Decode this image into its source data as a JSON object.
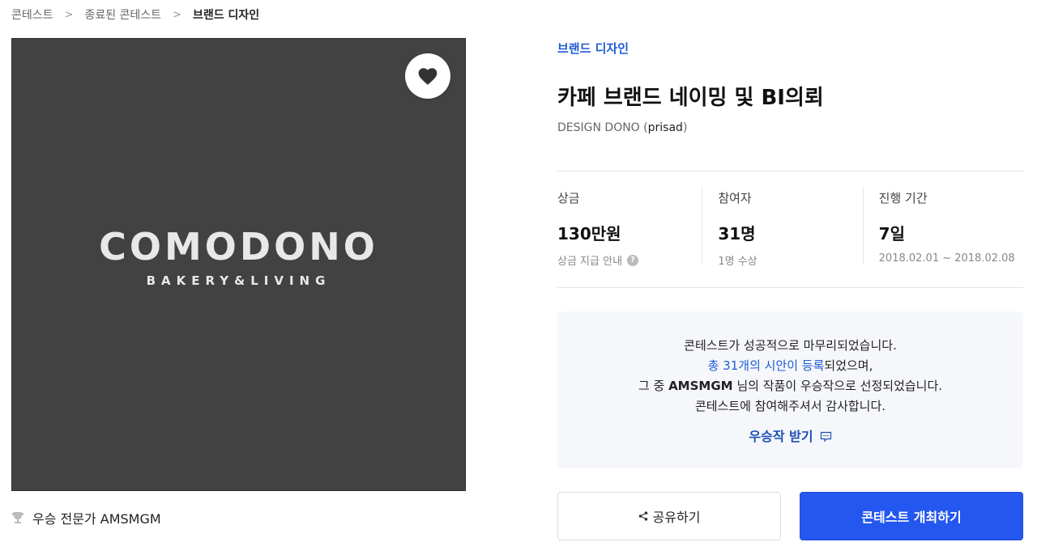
{
  "breadcrumb": {
    "items": [
      "콘테스트",
      "종료된 콘테스트",
      "브랜드 디자인"
    ]
  },
  "thumbnail": {
    "logo_main": "COMODONO",
    "logo_sub": "BAKERY&LIVING",
    "bg_color": "#424242"
  },
  "winner": {
    "label": "우승 전문가 AMSMGM",
    "icon": "trophy-icon"
  },
  "contest": {
    "category": "브랜드 디자인",
    "title": "카페 브랜드 네이밍 및 BI의뢰",
    "company": "DESIGN DONO",
    "user_open": " (",
    "user_id": "prisad",
    "user_close": ")"
  },
  "stats": {
    "prize": {
      "label": "상금",
      "value": "130만원",
      "sub": "상금 지급 안내",
      "help_icon": "?"
    },
    "participants": {
      "label": "참여자",
      "value": "31명",
      "sub": "1명 수상"
    },
    "period": {
      "label": "진행 기간",
      "value": "7일",
      "sub": "2018.02.01 ~ 2018.02.08"
    }
  },
  "notice": {
    "line1": "콘테스트가 성공적으로 마무리되었습니다.",
    "line2_link": "총 31개의 시안이 등록",
    "line2_rest": "되었으며,",
    "line3_pre": "그 중 ",
    "line3_name": "AMSMGM",
    "line3_rest": " 님의 작품이 우승작으로 선정되었습니다.",
    "line4": "콘테스트에 참여해주셔서 감사합니다.",
    "receive_label": "우승작 받기"
  },
  "buttons": {
    "share_label": "공유하기",
    "host_label": "콘테스트 개최하기"
  },
  "colors": {
    "accent": "#2457f0",
    "link": "#1f5bd6",
    "notice_bg": "#f5f7fa"
  }
}
